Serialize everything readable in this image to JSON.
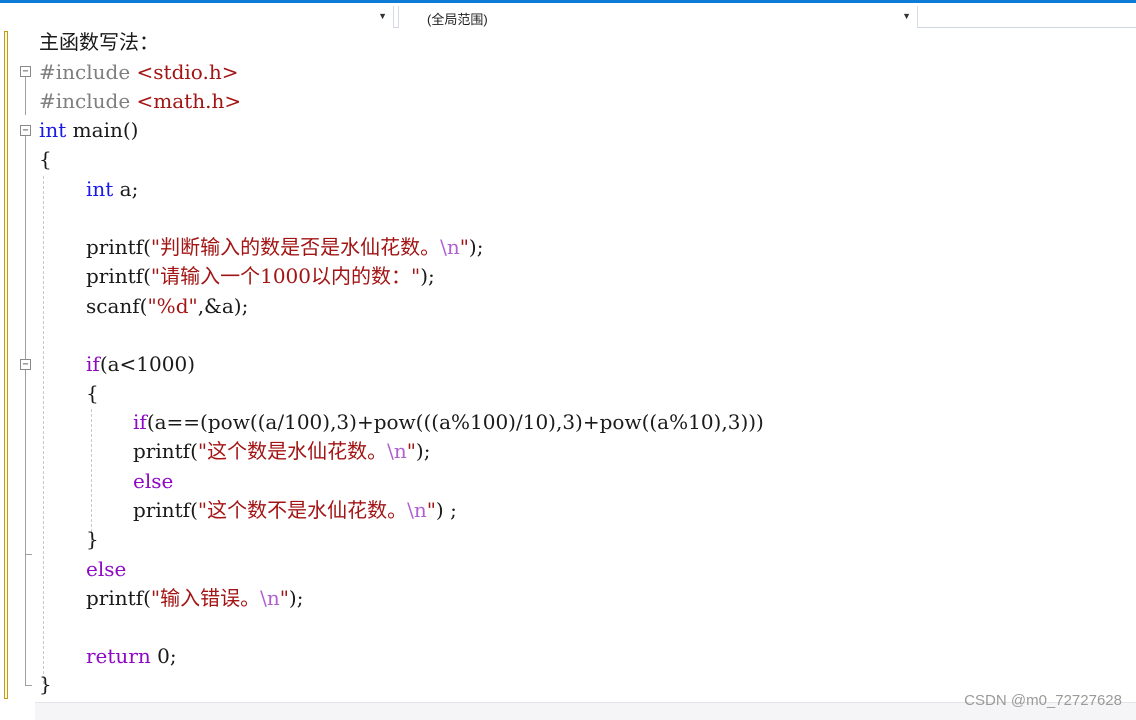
{
  "toolbar": {
    "scope_left": "",
    "scope_right": "(全局范围)"
  },
  "code": {
    "l1": "主函数写法：",
    "l2_pp": "#include",
    "l2_inc": "<stdio.h>",
    "l3_pp": "#include",
    "l3_inc": "<math.h>",
    "l4_kw": "int",
    "l4_rest": " main()",
    "l5": "{",
    "l6_kw": "int",
    "l6_rest": " a;",
    "l8_fn": "printf(",
    "l8_str": "\"判断输入的数是否是水仙花数。",
    "l8_esc": "\\n",
    "l8_q": "\"",
    "l8_end": ");",
    "l9_fn": "printf(",
    "l9_str": "\"请输入一个1000以内的数：\"",
    "l9_end": ");",
    "l10_fn": "scanf(",
    "l10_str": "\"%d\"",
    "l10_end": ",&a);",
    "l12_kw": "if",
    "l12_rest": "(a<1000)",
    "l13": "{",
    "l14_kw": "if",
    "l14_rest": "(a==(pow((a/100),3)+pow(((a%100)/10),3)+pow((a%10),3)))",
    "l15_fn": "printf(",
    "l15_str": "\"这个数是水仙花数。",
    "l15_esc": "\\n",
    "l15_q": "\"",
    "l15_end": ");",
    "l16_kw": "else",
    "l17_fn": "printf(",
    "l17_str": "\"这个数不是水仙花数。",
    "l17_esc": "\\n",
    "l17_q": "\"",
    "l17_end": ") ;",
    "l18": "}",
    "l19_kw": "else",
    "l20_fn": "printf(",
    "l20_str": "\"输入错误。",
    "l20_esc": "\\n",
    "l20_q": "\"",
    "l20_end": ");",
    "l22_kw": "return",
    "l22_rest": " 0;",
    "l23": "}"
  },
  "watermark": "CSDN @m0_72727628",
  "colors": {
    "keyword": "#1a1ae6",
    "control": "#8f08c4",
    "string": "#a31515",
    "escape": "#b060d0",
    "preprocessor": "#7f7f7f"
  }
}
